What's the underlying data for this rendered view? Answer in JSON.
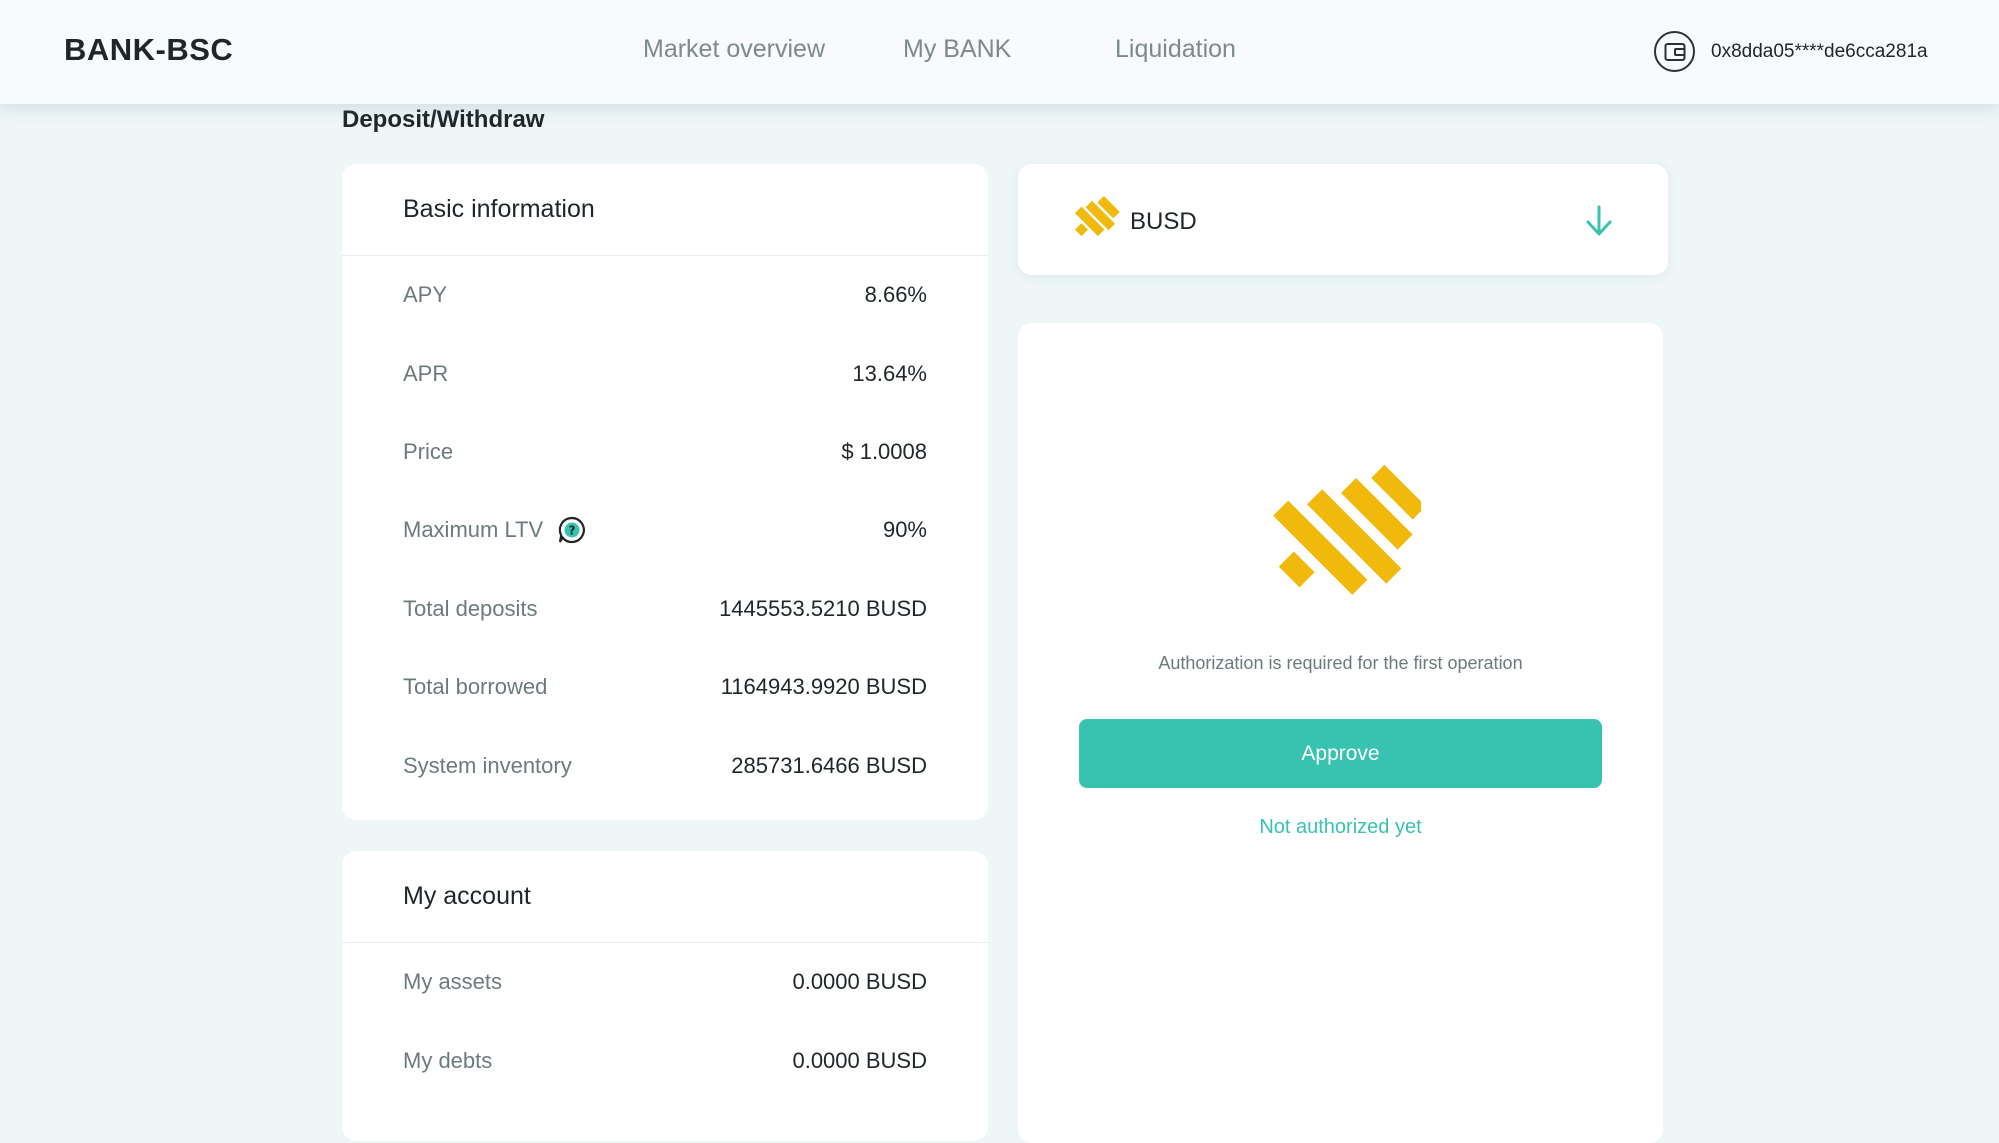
{
  "header": {
    "logo": "BANK-BSC",
    "nav": [
      "Market overview",
      "My BANK",
      "Liquidation"
    ],
    "wallet_address": "0x8dda05****de6cca281a"
  },
  "page": {
    "title": "Deposit/Withdraw"
  },
  "basic_info": {
    "title": "Basic information",
    "rows": [
      {
        "label": "APY",
        "value": "8.66%"
      },
      {
        "label": "APR",
        "value": "13.64%"
      },
      {
        "label": "Price",
        "value": "$ 1.0008"
      },
      {
        "label": "Maximum LTV",
        "value": "90%"
      },
      {
        "label": "Total deposits",
        "value": "1445553.5210 BUSD"
      },
      {
        "label": "Total borrowed",
        "value": "1164943.9920 BUSD"
      },
      {
        "label": "System inventory",
        "value": "285731.6466 BUSD"
      }
    ]
  },
  "my_account": {
    "title": "My account",
    "rows": [
      {
        "label": "My assets",
        "value": "0.0000 BUSD"
      },
      {
        "label": "My debts",
        "value": "0.0000 BUSD"
      }
    ]
  },
  "token": {
    "name": "BUSD",
    "icon": "busd-logo-icon"
  },
  "action": {
    "auth_message": "Authorization is required for the first operation",
    "approve_label": "Approve",
    "status": "Not authorized yet"
  },
  "colors": {
    "accent": "#38c2b0",
    "busd_yellow": "#f0b90b",
    "background": "#eef6f7"
  }
}
